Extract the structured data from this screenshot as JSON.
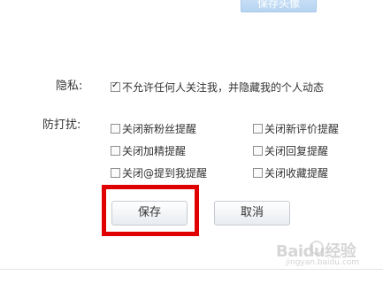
{
  "top_button_label": "保存头像",
  "privacy": {
    "label": "隐私:",
    "option": {
      "label": "不允许任何人关注我，并隐藏我的个人动态",
      "checked": true
    }
  },
  "disturb": {
    "label": "防打扰:",
    "options": [
      {
        "label": "关闭新粉丝提醒",
        "checked": false
      },
      {
        "label": "关闭新评价提醒",
        "checked": false
      },
      {
        "label": "关闭加精提醒",
        "checked": false
      },
      {
        "label": "关闭回复提醒",
        "checked": false
      },
      {
        "label": "关闭@提到我提醒",
        "checked": false
      },
      {
        "label": "关闭收藏提醒",
        "checked": false
      }
    ]
  },
  "buttons": {
    "save": "保存",
    "cancel": "取消"
  },
  "watermark": {
    "brand": "Baidu经验",
    "url": "jingyan.baidu.com"
  },
  "colors": {
    "highlight": "#e00000"
  }
}
